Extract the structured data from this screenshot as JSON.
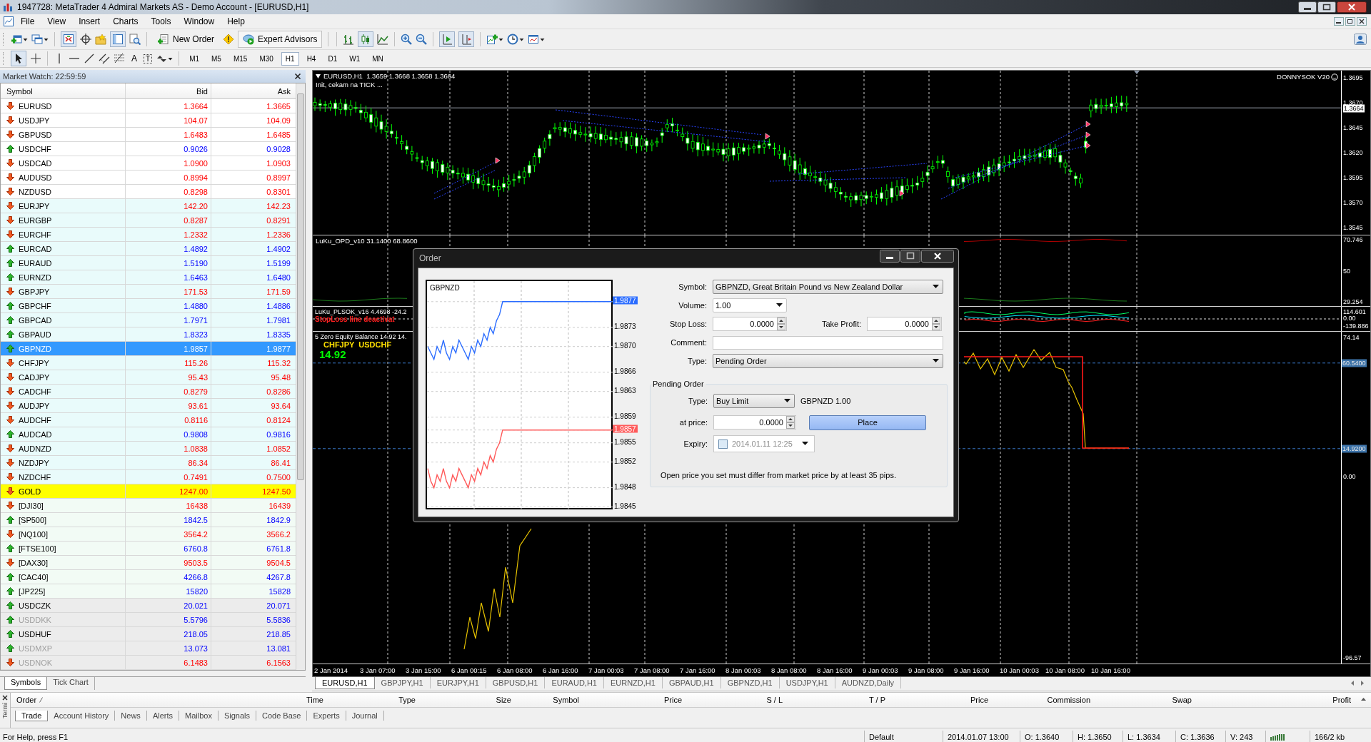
{
  "window": {
    "title": "1947728: MetaTrader 4 Admiral Markets AS - Demo Account - [EURUSD,H1]"
  },
  "menu": [
    "File",
    "View",
    "Insert",
    "Charts",
    "Tools",
    "Window",
    "Help"
  ],
  "toolbar": {
    "new_order": "New Order",
    "expert_advisors": "Expert Advisors"
  },
  "drawing_tools": {
    "text_tool": "A",
    "label_tool": "T"
  },
  "timeframes": [
    {
      "label": "M1",
      "selected": false
    },
    {
      "label": "M5",
      "selected": false
    },
    {
      "label": "M15",
      "selected": false
    },
    {
      "label": "M30",
      "selected": false
    },
    {
      "label": "H1",
      "selected": true
    },
    {
      "label": "H4",
      "selected": false
    },
    {
      "label": "D1",
      "selected": false
    },
    {
      "label": "W1",
      "selected": false
    },
    {
      "label": "MN",
      "selected": false
    }
  ],
  "market_watch": {
    "title": "Market Watch: 22:59:59",
    "columns": [
      "Symbol",
      "Bid",
      "Ask"
    ],
    "rows": [
      {
        "symbol": "EURUSD",
        "bid": "1.3664",
        "ask": "1.3665",
        "rising": false,
        "color": "#ffffff",
        "selected": false,
        "disabled": false
      },
      {
        "symbol": "USDJPY",
        "bid": "104.07",
        "ask": "104.09",
        "rising": false,
        "color": "#ffffff",
        "selected": false,
        "disabled": false
      },
      {
        "symbol": "GBPUSD",
        "bid": "1.6483",
        "ask": "1.6485",
        "rising": false,
        "color": "#ffffff",
        "selected": false,
        "disabled": false
      },
      {
        "symbol": "USDCHF",
        "bid": "0.9026",
        "ask": "0.9028",
        "rising": true,
        "color": "#ffffff",
        "selected": false,
        "disabled": false
      },
      {
        "symbol": "USDCAD",
        "bid": "1.0900",
        "ask": "1.0903",
        "rising": false,
        "color": "#ffffff",
        "selected": false,
        "disabled": false
      },
      {
        "symbol": "AUDUSD",
        "bid": "0.8994",
        "ask": "0.8997",
        "rising": false,
        "color": "#ffffff",
        "selected": false,
        "disabled": false
      },
      {
        "symbol": "NZDUSD",
        "bid": "0.8298",
        "ask": "0.8301",
        "rising": false,
        "color": "#ffffff",
        "selected": false,
        "disabled": false
      },
      {
        "symbol": "EURJPY",
        "bid": "142.20",
        "ask": "142.23",
        "rising": false,
        "color": "#e9fbfb",
        "selected": false,
        "disabled": false
      },
      {
        "symbol": "EURGBP",
        "bid": "0.8287",
        "ask": "0.8291",
        "rising": false,
        "color": "#e9fbfb",
        "selected": false,
        "disabled": false
      },
      {
        "symbol": "EURCHF",
        "bid": "1.2332",
        "ask": "1.2336",
        "rising": false,
        "color": "#e9fbfb",
        "selected": false,
        "disabled": false
      },
      {
        "symbol": "EURCAD",
        "bid": "1.4892",
        "ask": "1.4902",
        "rising": true,
        "color": "#e9fbfb",
        "selected": false,
        "disabled": false
      },
      {
        "symbol": "EURAUD",
        "bid": "1.5190",
        "ask": "1.5199",
        "rising": true,
        "color": "#e9fbfb",
        "selected": false,
        "disabled": false
      },
      {
        "symbol": "EURNZD",
        "bid": "1.6463",
        "ask": "1.6480",
        "rising": true,
        "color": "#e9fbfb",
        "selected": false,
        "disabled": false
      },
      {
        "symbol": "GBPJPY",
        "bid": "171.53",
        "ask": "171.59",
        "rising": false,
        "color": "#e9fbfb",
        "selected": false,
        "disabled": false
      },
      {
        "symbol": "GBPCHF",
        "bid": "1.4880",
        "ask": "1.4886",
        "rising": true,
        "color": "#e9fbfb",
        "selected": false,
        "disabled": false
      },
      {
        "symbol": "GBPCAD",
        "bid": "1.7971",
        "ask": "1.7981",
        "rising": true,
        "color": "#e9fbfb",
        "selected": false,
        "disabled": false
      },
      {
        "symbol": "GBPAUD",
        "bid": "1.8323",
        "ask": "1.8335",
        "rising": true,
        "color": "#e9fbfb",
        "selected": false,
        "disabled": false
      },
      {
        "symbol": "GBPNZD",
        "bid": "1.9857",
        "ask": "1.9877",
        "rising": true,
        "selected": true,
        "disabled": false
      },
      {
        "symbol": "CHFJPY",
        "bid": "115.26",
        "ask": "115.32",
        "rising": false,
        "color": "#e9fbfb",
        "selected": false,
        "disabled": false
      },
      {
        "symbol": "CADJPY",
        "bid": "95.43",
        "ask": "95.48",
        "rising": false,
        "color": "#e9fbfb",
        "selected": false,
        "disabled": false
      },
      {
        "symbol": "CADCHF",
        "bid": "0.8279",
        "ask": "0.8286",
        "rising": false,
        "color": "#e9fbfb",
        "selected": false,
        "disabled": false
      },
      {
        "symbol": "AUDJPY",
        "bid": "93.61",
        "ask": "93.64",
        "rising": false,
        "color": "#e9fbfb",
        "selected": false,
        "disabled": false
      },
      {
        "symbol": "AUDCHF",
        "bid": "0.8116",
        "ask": "0.8124",
        "rising": false,
        "color": "#e9fbfb",
        "selected": false,
        "disabled": false
      },
      {
        "symbol": "AUDCAD",
        "bid": "0.9808",
        "ask": "0.9816",
        "rising": true,
        "color": "#e9fbfb",
        "selected": false,
        "disabled": false
      },
      {
        "symbol": "AUDNZD",
        "bid": "1.0838",
        "ask": "1.0852",
        "rising": false,
        "color": "#e9fbfb",
        "selected": false,
        "disabled": false
      },
      {
        "symbol": "NZDJPY",
        "bid": "86.34",
        "ask": "86.41",
        "rising": false,
        "color": "#e9fbfb",
        "selected": false,
        "disabled": false
      },
      {
        "symbol": "NZDCHF",
        "bid": "0.7491",
        "ask": "0.7500",
        "rising": false,
        "color": "#e9fbfb",
        "selected": false,
        "disabled": false
      },
      {
        "symbol": "GOLD",
        "bid": "1247.00",
        "ask": "1247.50",
        "rising": false,
        "color": "#ffff00",
        "selected": false,
        "disabled": false
      },
      {
        "symbol": "[DJI30]",
        "bid": "16438",
        "ask": "16439",
        "rising": false,
        "color": "#f2fbf5",
        "selected": false,
        "disabled": false
      },
      {
        "symbol": "[SP500]",
        "bid": "1842.5",
        "ask": "1842.9",
        "rising": true,
        "color": "#f2fbf5",
        "selected": false,
        "disabled": false
      },
      {
        "symbol": "[NQ100]",
        "bid": "3564.2",
        "ask": "3566.2",
        "rising": false,
        "color": "#f2fbf5",
        "selected": false,
        "disabled": false
      },
      {
        "symbol": "[FTSE100]",
        "bid": "6760.8",
        "ask": "6761.8",
        "rising": true,
        "color": "#f2fbf5",
        "selected": false,
        "disabled": false
      },
      {
        "symbol": "[DAX30]",
        "bid": "9503.5",
        "ask": "9504.5",
        "rising": false,
        "color": "#f2fbf5",
        "selected": false,
        "disabled": false
      },
      {
        "symbol": "[CAC40]",
        "bid": "4266.8",
        "ask": "4267.8",
        "rising": true,
        "color": "#f2fbf5",
        "selected": false,
        "disabled": false
      },
      {
        "symbol": "[JP225]",
        "bid": "15820",
        "ask": "15828",
        "rising": true,
        "color": "#f2fbf5",
        "selected": false,
        "disabled": false
      },
      {
        "symbol": "USDCZK",
        "bid": "20.021",
        "ask": "20.071",
        "rising": true,
        "color": "#ececec",
        "selected": false,
        "disabled": false
      },
      {
        "symbol": "USDDKK",
        "bid": "5.5796",
        "ask": "5.5836",
        "rising": true,
        "color": "#ececec",
        "selected": false,
        "disabled": true
      },
      {
        "symbol": "USDHUF",
        "bid": "218.05",
        "ask": "218.85",
        "rising": true,
        "color": "#ececec",
        "selected": false,
        "disabled": false
      },
      {
        "symbol": "USDMXP",
        "bid": "13.073",
        "ask": "13.081",
        "rising": true,
        "color": "#ececec",
        "selected": false,
        "disabled": true
      },
      {
        "symbol": "USDNOK",
        "bid": "6.1483",
        "ask": "6.1563",
        "rising": false,
        "color": "#ececec",
        "selected": false,
        "disabled": true
      }
    ],
    "tabs": [
      {
        "label": "Symbols",
        "selected": true
      },
      {
        "label": "Tick Chart",
        "selected": false
      }
    ]
  },
  "chart": {
    "header": "EURUSD,H1  1.3659 1.3668 1.3658 1.3664",
    "status": "Init, cekam na TICK ...",
    "expert": "DONNYSOK V20",
    "price_labels": [
      {
        "text": "1.3695",
        "kind": "tick"
      },
      {
        "text": "1.3670",
        "kind": "tick"
      },
      {
        "text": "1.3664",
        "kind": "bid"
      },
      {
        "text": "1.3645",
        "kind": "tick"
      },
      {
        "text": "1.3620",
        "kind": "tick"
      },
      {
        "text": "1.3595",
        "kind": "tick"
      },
      {
        "text": "1.3570",
        "kind": "tick"
      },
      {
        "text": "1.3545",
        "kind": "tick"
      }
    ],
    "indicators": [
      {
        "title": "LuKu_OPD_v10 31.1400 68.8600",
        "labels": [
          {
            "text": "70.746",
            "kind": "tick"
          },
          {
            "text": "50",
            "kind": "tick"
          },
          {
            "text": "29.254",
            "kind": "tick"
          }
        ]
      },
      {
        "title": "LuKu_PLSOK_v16 4.4698 -24.2",
        "message": "StopLoss line deactivat",
        "labels": [
          {
            "text": "114.601",
            "kind": "tick"
          },
          {
            "text": "0.00",
            "kind": "tick"
          },
          {
            "text": "-139.886",
            "kind": "tick"
          }
        ]
      },
      {
        "title": "5 Zero Equity Balance 14.92 14.",
        "pairs": "CHFJPY  USDCHF",
        "value": "14.92",
        "labels": [
          {
            "text": "74.14",
            "kind": "tick"
          },
          {
            "text": "60.5400",
            "kind": "level"
          },
          {
            "text": "14.9200",
            "kind": "level"
          },
          {
            "text": "0.00",
            "kind": "tick"
          },
          {
            "text": "-96.57",
            "kind": "tick"
          }
        ]
      }
    ],
    "time_labels": [
      "2 Jan 2014",
      "3 Jan 07:00",
      "3 Jan 15:00",
      "6 Jan 00:15",
      "6 Jan 08:00",
      "6 Jan 16:00",
      "7 Jan 00:03",
      "7 Jan 08:00",
      "7 Jan 16:00",
      "8 Jan 00:03",
      "8 Jan 08:00",
      "8 Jan 16:00",
      "9 Jan 00:03",
      "9 Jan 08:00",
      "9 Jan 16:00",
      "10 Jan 00:03",
      "10 Jan 08:00",
      "10 Jan 16:00"
    ],
    "tabs": [
      {
        "label": "EURUSD,H1",
        "selected": true
      },
      {
        "label": "GBPJPY,H1",
        "selected": false
      },
      {
        "label": "EURJPY,H1",
        "selected": false
      },
      {
        "label": "GBPUSD,H1",
        "selected": false
      },
      {
        "label": "EURAUD,H1",
        "selected": false
      },
      {
        "label": "EURNZD,H1",
        "selected": false
      },
      {
        "label": "GBPAUD,H1",
        "selected": false
      },
      {
        "label": "GBPNZD,H1",
        "selected": false
      },
      {
        "label": "USDJPY,H1",
        "selected": false
      },
      {
        "label": "AUDNZD,Daily",
        "selected": false
      }
    ]
  },
  "order_dialog": {
    "title": "Order",
    "chart": {
      "symbol": "GBPNZD",
      "chart_data": {
        "type": "line",
        "grid": true,
        "ylim": [
          1.98444,
          1.98802
        ],
        "yticks": [
          {
            "value": 1.9877,
            "label": "1.9877"
          },
          {
            "value": 1.9873,
            "label": "1.9873"
          },
          {
            "value": 1.987,
            "label": "1.9870"
          },
          {
            "value": 1.9866,
            "label": "1.9866"
          },
          {
            "value": 1.9863,
            "label": "1.9863"
          },
          {
            "value": 1.9859,
            "label": "1.9859"
          },
          {
            "value": 1.9857,
            "label": "1.9857"
          },
          {
            "value": 1.9855,
            "label": "1.9855"
          },
          {
            "value": 1.9852,
            "label": "1.9852"
          },
          {
            "value": 1.9848,
            "label": "1.9848"
          },
          {
            "value": 1.9845,
            "label": "1.9845"
          }
        ],
        "series": [
          {
            "color": "#2a6cff",
            "values": [
              1.987,
              1.9869,
              1.9868,
              1.987,
              1.9869,
              1.9871,
              1.9869,
              1.9868,
              1.987,
              1.9869,
              1.9871,
              1.987,
              1.9869,
              1.9868,
              1.987,
              1.9869,
              1.9871,
              1.987,
              1.9872,
              1.9871,
              1.9873,
              1.9872,
              1.9874,
              1.9875,
              1.9877,
              1.9877,
              1.9877,
              1.9877,
              1.9877,
              1.9877,
              1.9877,
              1.9877,
              1.9877,
              1.9877,
              1.9877,
              1.9877,
              1.9877,
              1.9877,
              1.9877,
              1.9877,
              1.9877,
              1.9877,
              1.9877,
              1.9877,
              1.9877,
              1.9877,
              1.9877,
              1.9877,
              1.9877,
              1.9877,
              1.9877,
              1.9877,
              1.9877,
              1.9877,
              1.9877,
              1.9877,
              1.9877,
              1.9877,
              1.9877,
              1.9877
            ]
          },
          {
            "color": "#ff5a5a",
            "values": [
              1.9851,
              1.9849,
              1.9848,
              1.985,
              1.9849,
              1.9851,
              1.9849,
              1.9848,
              1.985,
              1.9849,
              1.9851,
              1.985,
              1.9849,
              1.9848,
              1.985,
              1.9849,
              1.9851,
              1.985,
              1.9852,
              1.9851,
              1.9853,
              1.9852,
              1.9854,
              1.9855,
              1.9857,
              1.9857,
              1.9857,
              1.9857,
              1.9857,
              1.9857,
              1.9857,
              1.9857,
              1.9857,
              1.9857,
              1.9857,
              1.9857,
              1.9857,
              1.9857,
              1.9857,
              1.9857,
              1.9857,
              1.9857,
              1.9857,
              1.9857,
              1.9857,
              1.9857,
              1.9857,
              1.9857,
              1.9857,
              1.9857,
              1.9857,
              1.9857,
              1.9857,
              1.9857,
              1.9857,
              1.9857,
              1.9857,
              1.9857,
              1.9857,
              1.9857
            ]
          }
        ]
      }
    },
    "symbol": {
      "label": "Symbol:",
      "value": "GBPNZD, Great Britain Pound vs New Zealand Dollar"
    },
    "volume": {
      "label": "Volume:",
      "value": "1.00"
    },
    "stop_loss": {
      "label": "Stop Loss:",
      "value": "0.0000"
    },
    "take_profit": {
      "label": "Take Profit:",
      "value": "0.0000"
    },
    "comment": {
      "label": "Comment:"
    },
    "type": {
      "label": "Type:",
      "value": "Pending Order"
    },
    "pending": {
      "title": "Pending Order",
      "type": {
        "label": "Type:",
        "value": "Buy Limit"
      },
      "summary": "GBPNZD 1.00",
      "price": {
        "label": "at price:",
        "value": "0.0000"
      },
      "place_button": "Place",
      "expiry": {
        "label": "Expiry:",
        "checked": false,
        "value": "2014.01.11 12:25"
      },
      "note": "Open price you set must differ from market price by at least 35 pips."
    }
  },
  "terminal": {
    "side_label": "Termi",
    "columns": [
      "Order",
      "Time",
      "Type",
      "Size",
      "Symbol",
      "Price",
      "S / L",
      "T / P",
      "Price",
      "Commission",
      "Swap",
      "Profit"
    ],
    "tabs": [
      {
        "label": "Trade",
        "selected": true
      },
      {
        "label": "Account History",
        "selected": false
      },
      {
        "label": "News",
        "selected": false
      },
      {
        "label": "Alerts",
        "selected": false
      },
      {
        "label": "Mailbox",
        "selected": false
      },
      {
        "label": "Signals",
        "selected": false
      },
      {
        "label": "Code Base",
        "selected": false
      },
      {
        "label": "Experts",
        "selected": false
      },
      {
        "label": "Journal",
        "selected": false
      }
    ]
  },
  "status_bar": {
    "help": "For Help, press F1",
    "profile": "Default",
    "time": "2014.01.07 13:00",
    "open": "O: 1.3640",
    "high": "H: 1.3650",
    "low": "L: 1.3634",
    "close": "C: 1.3636",
    "volume": "V: 243",
    "traffic": "166/2 kb"
  }
}
